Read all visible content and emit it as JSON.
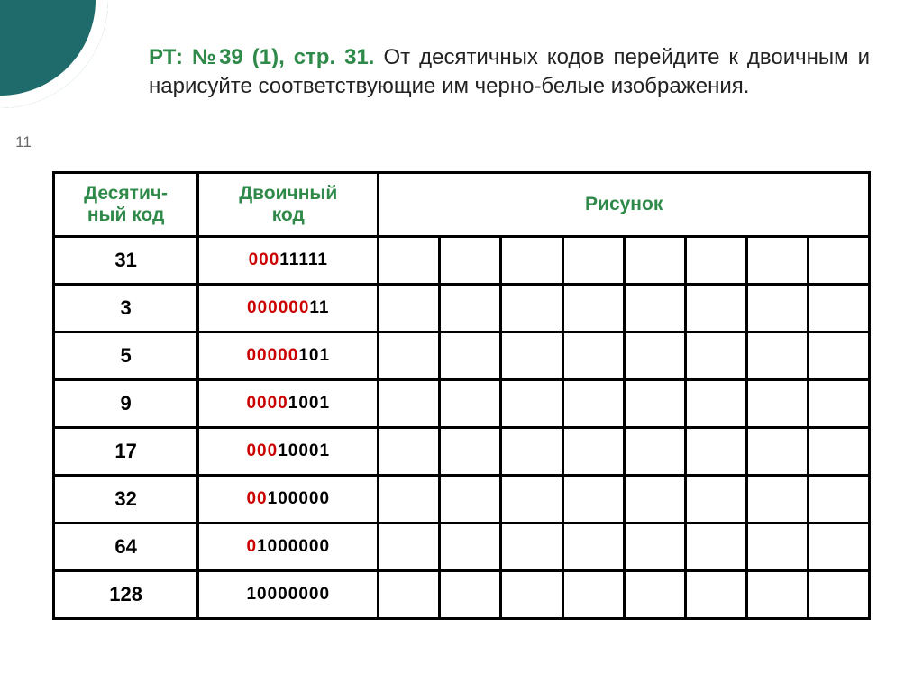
{
  "page_number": "11",
  "headline": {
    "lead": "РТ: №39 (1), стр. 31.",
    "rest": " От десятичных кодов перейдите к двоичным и нарисуйте соответствующие им черно-белые изображения."
  },
  "table": {
    "headers": {
      "decimal": "Десятич-\nный код",
      "binary": "Двоичный\nкод",
      "picture": "Рисунок"
    },
    "rows": [
      {
        "dec": "31",
        "bin_zeros": "000",
        "bin_rest": "11111"
      },
      {
        "dec": "3",
        "bin_zeros": "000000",
        "bin_rest": "11"
      },
      {
        "dec": "5",
        "bin_zeros": "00000",
        "bin_rest": "101"
      },
      {
        "dec": "9",
        "bin_zeros": "0000",
        "bin_rest": "1001"
      },
      {
        "dec": "17",
        "bin_zeros": "000",
        "bin_rest": "10001"
      },
      {
        "dec": "32",
        "bin_zeros": "00",
        "bin_rest": "100000"
      },
      {
        "dec": "64",
        "bin_zeros": "0",
        "bin_rest": "1000000"
      },
      {
        "dec": "128",
        "bin_zeros": "",
        "bin_rest": "10000000"
      }
    ]
  }
}
